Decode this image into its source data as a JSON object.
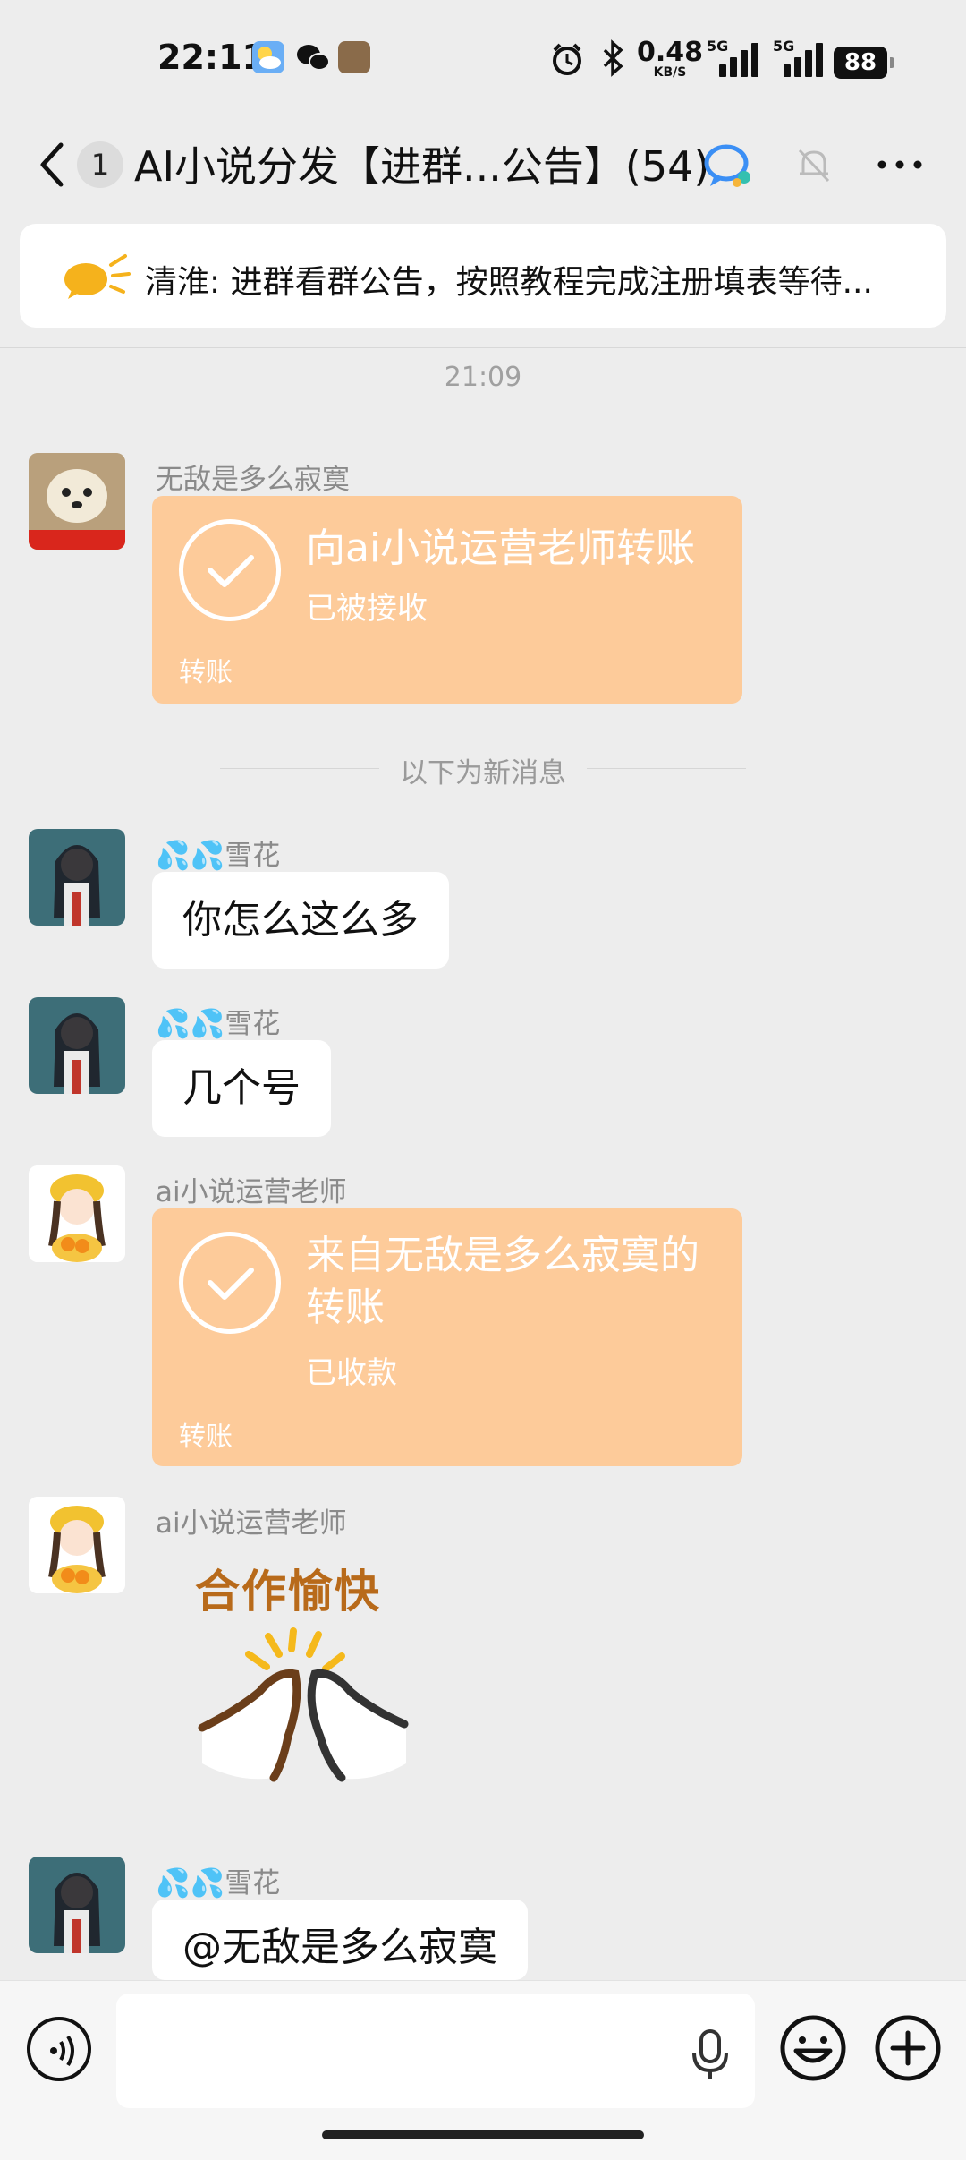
{
  "status_bar": {
    "time": "22:11",
    "net_rate": "0.48",
    "net_unit": "KB/S",
    "net1": "5G",
    "net2": "5G",
    "battery": "88"
  },
  "header": {
    "unread_count": "1",
    "title": "AI小说分发【进群...公告】(54)"
  },
  "announcement": {
    "text": "清淮: 进群看群公告，按照教程完成注册填表等待..."
  },
  "chat": {
    "timestamp": "21:09",
    "new_messages_divider": "以下为新消息",
    "messages": [
      {
        "sender": "无敌是多么寂寞",
        "type": "transfer",
        "title": "向ai小说运营老师转账",
        "status": "已被接收",
        "label": "转账"
      },
      {
        "sender": "💦💦雪花",
        "type": "text",
        "text": "你怎么这么多"
      },
      {
        "sender": "💦💦雪花",
        "type": "text",
        "text": "几个号"
      },
      {
        "sender": "ai小说运营老师",
        "type": "transfer",
        "title": "来自无敌是多么寂寞的转账",
        "status": "已收款",
        "label": "转账"
      },
      {
        "sender": "ai小说运营老师",
        "type": "sticker",
        "sticker_text": "合作愉快"
      },
      {
        "sender": "💦💦雪花",
        "type": "text",
        "text": "@无敌是多么寂寞"
      }
    ]
  },
  "colors": {
    "background": "#ededed",
    "transfer_card": "#fdcb9a",
    "bubble": "#ffffff"
  },
  "icons": [
    "back-icon",
    "qq-group-icon",
    "bell-muted-icon",
    "more-icon",
    "announcement-icon",
    "voice-icon",
    "mic-icon",
    "emoji-icon",
    "plus-icon"
  ]
}
